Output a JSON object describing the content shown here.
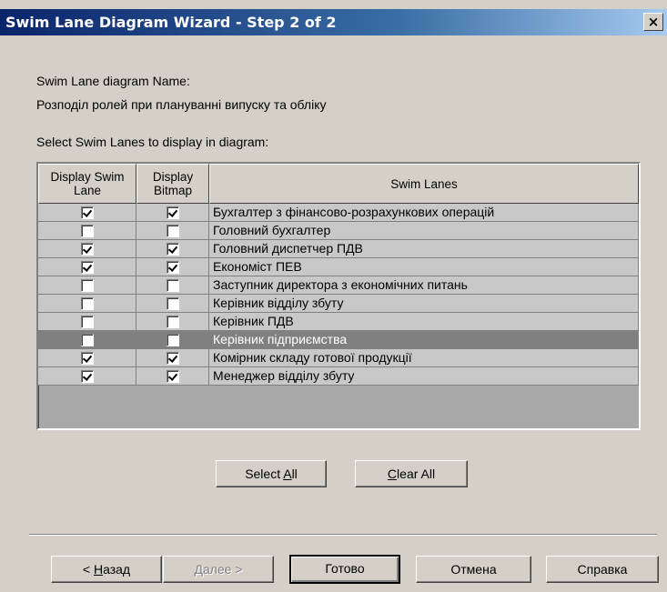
{
  "window": {
    "title": "Swim Lane Diagram Wizard - Step 2 of 2",
    "close_label": "×"
  },
  "form": {
    "name_label": "Swim Lane diagram Name:",
    "name_value": "Розподіл ролей при плануванні випуску та обліку",
    "select_label": "Select Swim Lanes to display in diagram:"
  },
  "grid": {
    "headers": {
      "display_lane": "Display Swim Lane",
      "display_bitmap": "Display Bitmap",
      "swim_lanes": "Swim Lanes"
    },
    "rows": [
      {
        "display": true,
        "bitmap": true,
        "name": "Бухгалтер з фінансово-розрахункових операцій",
        "selected": false
      },
      {
        "display": false,
        "bitmap": false,
        "name": "Головний бухгалтер",
        "selected": false
      },
      {
        "display": true,
        "bitmap": true,
        "name": "Головний диспетчер ПДВ",
        "selected": false
      },
      {
        "display": true,
        "bitmap": true,
        "name": "Економіст ПЕВ",
        "selected": false
      },
      {
        "display": false,
        "bitmap": false,
        "name": "Заступник директора з економічних питань",
        "selected": false
      },
      {
        "display": false,
        "bitmap": false,
        "name": "Керівник відділу збуту",
        "selected": false
      },
      {
        "display": false,
        "bitmap": false,
        "name": "Керівник ПДВ",
        "selected": false
      },
      {
        "display": false,
        "bitmap": false,
        "name": "Керівник підприємства",
        "selected": true
      },
      {
        "display": true,
        "bitmap": true,
        "name": "Комірник складу готової продукції",
        "selected": false
      },
      {
        "display": true,
        "bitmap": true,
        "name": "Менеджер відділу збуту",
        "selected": false
      }
    ]
  },
  "buttons": {
    "select_all": {
      "prefix": "Select ",
      "accel": "A",
      "suffix": "ll"
    },
    "clear_all": {
      "prefix": "",
      "accel": "C",
      "suffix": "lear All"
    },
    "back": {
      "prefix": "< ",
      "accel": "Н",
      "suffix": "азад"
    },
    "next": {
      "prefix": "",
      "accel": "Д",
      "suffix": "алее >"
    },
    "finish": "Готово",
    "cancel": "Отмена",
    "help": "Справка"
  },
  "colors": {
    "title_bar": "#0a246a",
    "dialog_bg": "#d4d0c8",
    "selected_row": "#808080"
  }
}
